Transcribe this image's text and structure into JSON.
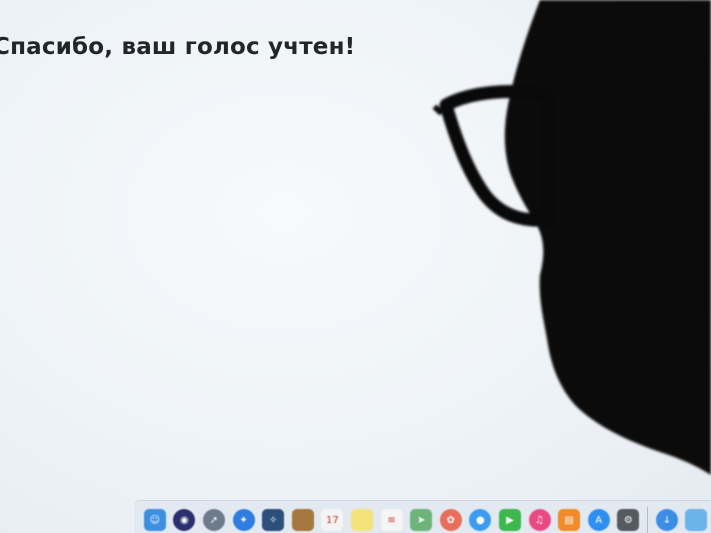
{
  "screen": {
    "message": "Спасибо, ваш голос учтен!"
  },
  "dock": {
    "items": [
      {
        "name": "finder-icon",
        "color": "#3d8fe0",
        "glyph": "☺"
      },
      {
        "name": "siri-icon",
        "color": "#2c2f6e",
        "glyph": "◉"
      },
      {
        "name": "launchpad-icon",
        "color": "#6e7b8c",
        "glyph": "➚"
      },
      {
        "name": "safari-icon",
        "color": "#2f7de0",
        "glyph": "✦"
      },
      {
        "name": "photo-booth-icon",
        "color": "#2d4f7c",
        "glyph": "✧"
      },
      {
        "name": "contacts-icon",
        "color": "#a4773e",
        "glyph": ""
      },
      {
        "name": "calendar-icon",
        "color": "#f4f4f4",
        "glyph": "17"
      },
      {
        "name": "notes-icon",
        "color": "#f6e27a",
        "glyph": ""
      },
      {
        "name": "reminders-icon",
        "color": "#f5f5f5",
        "glyph": "≡"
      },
      {
        "name": "maps-icon",
        "color": "#6db37a",
        "glyph": "➤"
      },
      {
        "name": "photos-icon",
        "color": "#e86e5a",
        "glyph": "✿"
      },
      {
        "name": "messages-icon",
        "color": "#3b9cf0",
        "glyph": "●"
      },
      {
        "name": "facetime-icon",
        "color": "#3cb84c",
        "glyph": "▶"
      },
      {
        "name": "itunes-icon",
        "color": "#e94a84",
        "glyph": "♫"
      },
      {
        "name": "ibooks-icon",
        "color": "#f08a2a",
        "glyph": "▤"
      },
      {
        "name": "app-store-icon",
        "color": "#2f8ff0",
        "glyph": "A"
      },
      {
        "name": "system-preferences-icon",
        "color": "#555a60",
        "glyph": "⚙"
      },
      {
        "name": "downloads-icon",
        "color": "#3c8de6",
        "glyph": "↓"
      },
      {
        "name": "folder-icon",
        "color": "#6cb3ea",
        "glyph": ""
      }
    ]
  }
}
